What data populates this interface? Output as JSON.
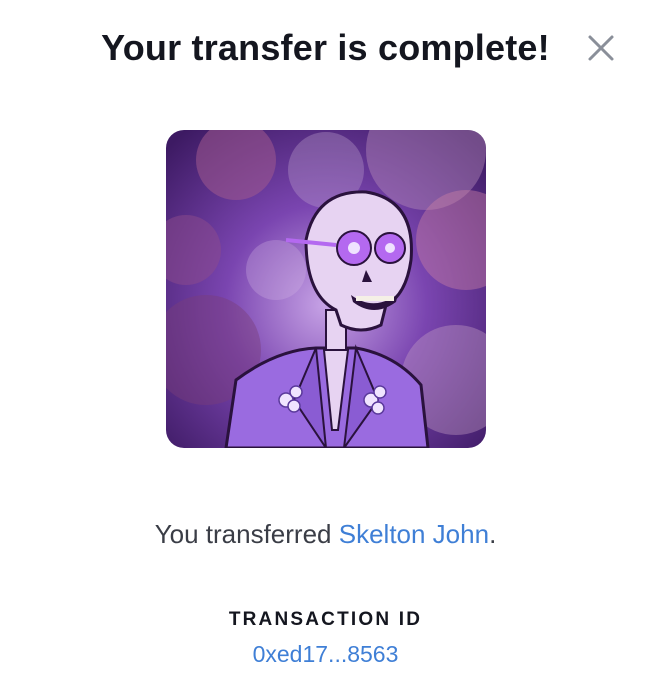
{
  "modal": {
    "title": "Your transfer is complete!",
    "close_icon": "close-icon"
  },
  "nft": {
    "name": "Skelton John",
    "image_icon": "skeleton-nft-artwork",
    "palette": {
      "background": "#5a2d86",
      "suit": "#9a6be0",
      "skull": "#e7d3f2",
      "glasses": "#b469f0"
    }
  },
  "message": {
    "prefix": "You transferred ",
    "name": "Skelton John",
    "suffix": "."
  },
  "transaction": {
    "label": "TRANSACTION ID",
    "id": "0xed17...8563"
  },
  "colors": {
    "text": "#14161f",
    "link": "#3f7fd6",
    "muted": "#3a3d46"
  }
}
